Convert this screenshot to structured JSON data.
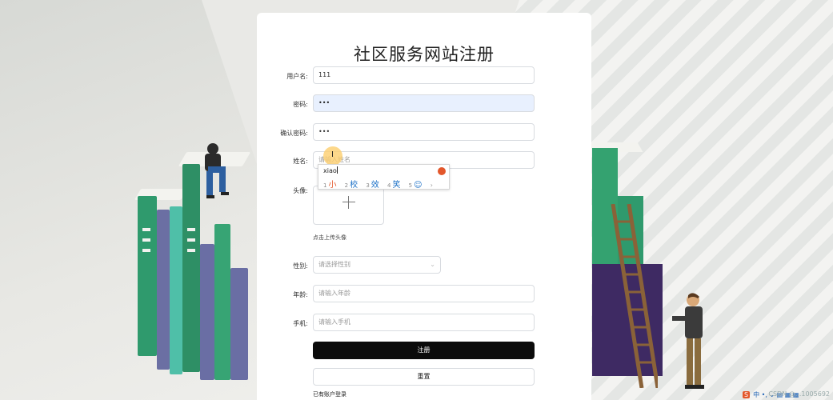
{
  "form": {
    "title": "社区服务网站注册",
    "fields": {
      "username": {
        "label": "用户名:",
        "value": "111"
      },
      "password": {
        "label": "密码:",
        "value": "•••"
      },
      "confirm": {
        "label": "确认密码:",
        "value": "•••"
      },
      "name": {
        "label": "姓名:",
        "placeholder": "请输入姓名"
      },
      "avatar": {
        "label": "头像:",
        "hint": "点击上传头像"
      },
      "gender": {
        "label": "性别:",
        "placeholder": "请选择性别"
      },
      "age": {
        "label": "年龄:",
        "placeholder": "请输入年龄"
      },
      "phone": {
        "label": "手机:",
        "placeholder": "请输入手机"
      }
    },
    "submit_label": "注册",
    "reset_label": "重置",
    "login_link": "已有账户登录"
  },
  "ime": {
    "composition": "xiao",
    "candidates": [
      {
        "num": "1",
        "text": "小"
      },
      {
        "num": "2",
        "text": "校"
      },
      {
        "num": "3",
        "text": "效"
      },
      {
        "num": "4",
        "text": "笑"
      },
      {
        "num": "5",
        "text": ""
      }
    ],
    "more": "›"
  },
  "tray": {
    "ime_logo": "S",
    "text": "中 •, ⌄ ▤ ▦ ▦"
  },
  "watermark": "CSDN @...1005692",
  "colors": {
    "primary_button": "#0b0b0b",
    "autofill_bg": "#e8f0fe",
    "book_green": "#2f9a6d",
    "book_purple": "#6b6fa3"
  }
}
